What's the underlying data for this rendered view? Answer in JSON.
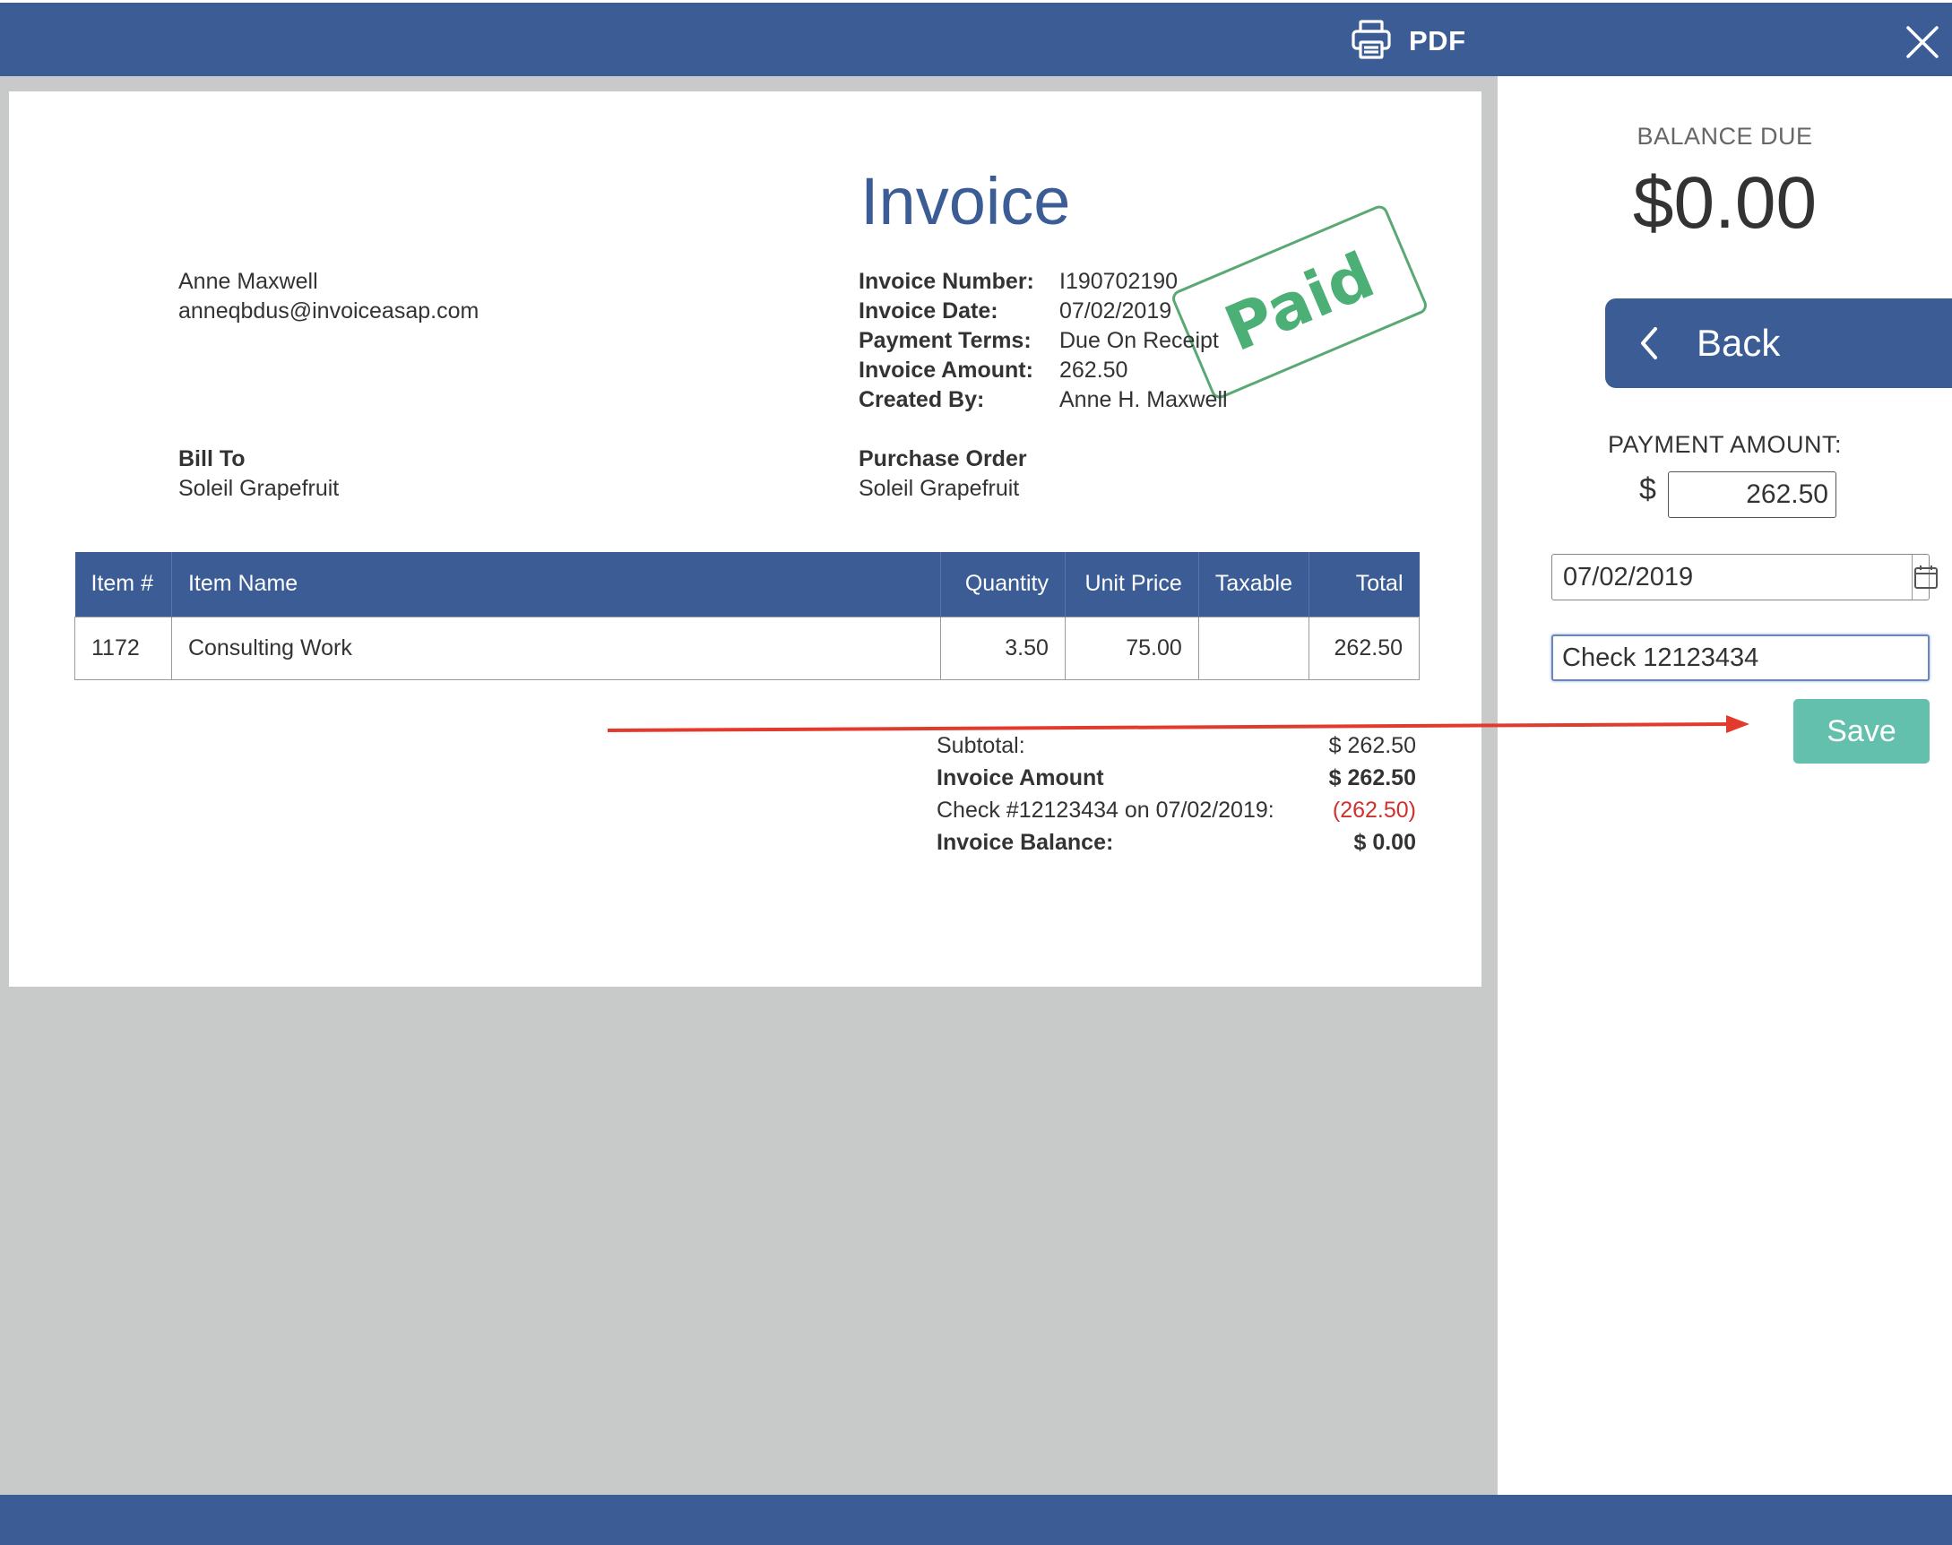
{
  "toolbar": {
    "pdf_label": "PDF"
  },
  "invoice": {
    "title": "Invoice",
    "stamp": "Paid",
    "from": {
      "name": "Anne Maxwell",
      "email": "anneqbdus@invoiceasap.com"
    },
    "meta": [
      {
        "label": "Invoice Number:",
        "value": "I190702190"
      },
      {
        "label": "Invoice Date:",
        "value": "07/02/2019"
      },
      {
        "label": "Payment Terms:",
        "value": "Due On Receipt"
      },
      {
        "label": "Invoice Amount:",
        "value": "262.50"
      },
      {
        "label": "Created By:",
        "value": "Anne H. Maxwell"
      }
    ],
    "bill_to": {
      "heading": "Bill To",
      "name": "Soleil Grapefruit"
    },
    "purchase_order": {
      "heading": "Purchase Order",
      "name": "Soleil Grapefruit"
    },
    "table": {
      "headers": [
        "Item #",
        "Item Name",
        "Quantity",
        "Unit Price",
        "Taxable",
        "Total"
      ],
      "rows": [
        [
          "1172",
          "Consulting Work",
          "3.50",
          "75.00",
          "",
          "262.50"
        ]
      ]
    },
    "totals": {
      "subtotal_label": "Subtotal:",
      "subtotal_value": "$ 262.50",
      "amount_label": "Invoice Amount",
      "amount_value": "$ 262.50",
      "payment_label": "Check #12123434 on 07/02/2019:",
      "payment_value": "(262.50)",
      "balance_label": "Invoice Balance:",
      "balance_value": "$ 0.00"
    }
  },
  "panel": {
    "balance_due_label": "BALANCE DUE",
    "balance_due_value": "$0.00",
    "back_label": "Back",
    "payment_amount_label": "PAYMENT AMOUNT:",
    "currency_symbol": "$",
    "payment_amount_value": "262.50",
    "payment_date_value": "07/02/2019",
    "payment_note_value": "Check 12123434",
    "save_label": "Save"
  },
  "colors": {
    "brand": "#3b5c94",
    "stamp": "#4caf75",
    "save": "#63c0ad",
    "negative": "#d0312d",
    "annotation_arrow": "#e23b2e"
  },
  "icons": {
    "pdf": "printer-icon",
    "close": "close-icon",
    "back": "chevron-left-icon",
    "calendar": "calendar-icon"
  }
}
